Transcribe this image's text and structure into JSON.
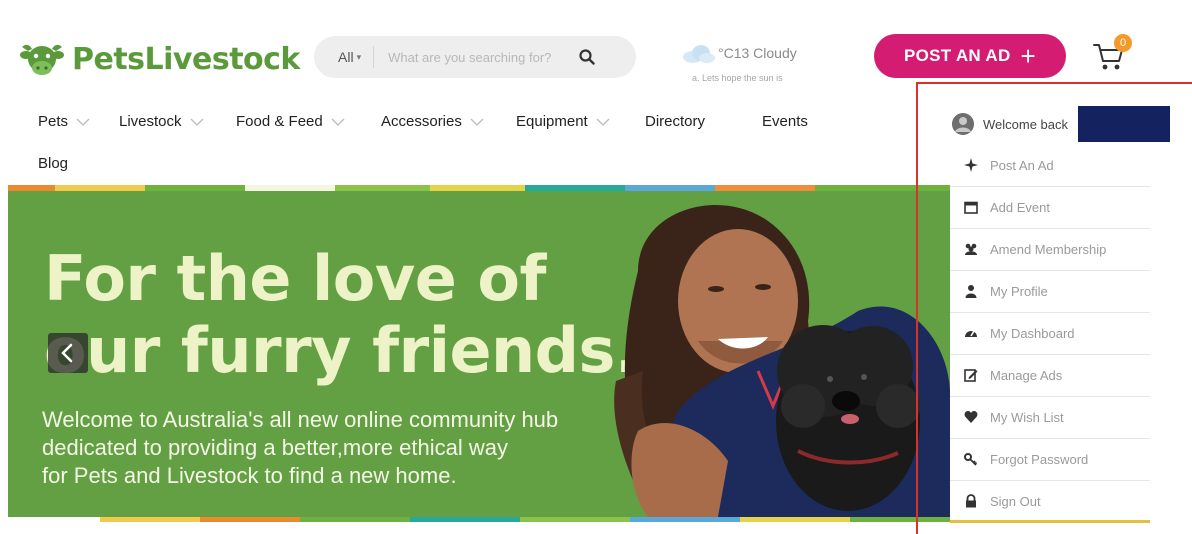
{
  "header": {
    "logo_text": "PetsLivestock",
    "search": {
      "category": "All",
      "placeholder": "What are you searching for?"
    },
    "weather": {
      "temp": "°C13 Cloudy",
      "note": "a. Lets hope the sun is"
    },
    "post_ad_label": "POST AN AD",
    "post_ad_plus": "+",
    "cart_count": "0",
    "brand_color": "#d41d72",
    "logo_color": "#5a9a3a"
  },
  "nav": {
    "items": [
      {
        "label": "Pets",
        "has_dropdown": true
      },
      {
        "label": "Livestock",
        "has_dropdown": true
      },
      {
        "label": "Food & Feed",
        "has_dropdown": true
      },
      {
        "label": "Accessories",
        "has_dropdown": true
      },
      {
        "label": "Equipment",
        "has_dropdown": true
      },
      {
        "label": "Directory",
        "has_dropdown": false
      },
      {
        "label": "Events",
        "has_dropdown": false
      },
      {
        "label": "Blog",
        "has_dropdown": false
      }
    ]
  },
  "hero": {
    "headline_line1": "For the love of",
    "headline_line2": "our furry friends.",
    "sub_line1": "Welcome to Australia's all new online community hub",
    "sub_line2": "dedicated to providing a better,more ethical way",
    "sub_line3": "for Pets and Livestock to find a new home.",
    "background_color": "#62a043",
    "stripe_colors": [
      "#e98a2f",
      "#5aa8d8",
      "#f2c94c",
      "#6db23f",
      "#e15a4d",
      "#27a99a",
      "#e5d34b",
      "#d95b9b",
      "#8bc34a",
      "#f08c3a"
    ]
  },
  "user_menu": {
    "welcome": "Welcome back",
    "items": [
      {
        "label": "Post An Ad",
        "icon": "sparkle-icon"
      },
      {
        "label": "Add Event",
        "icon": "calendar-icon"
      },
      {
        "label": "Amend Membership",
        "icon": "group-icon"
      },
      {
        "label": "My Profile",
        "icon": "person-icon"
      },
      {
        "label": "My Dashboard",
        "icon": "gauge-icon"
      },
      {
        "label": "Manage Ads",
        "icon": "edit-icon"
      },
      {
        "label": "My Wish List",
        "icon": "heart-icon"
      },
      {
        "label": "Forgot Password",
        "icon": "key-icon"
      },
      {
        "label": "Sign Out",
        "icon": "lock-icon"
      }
    ]
  }
}
